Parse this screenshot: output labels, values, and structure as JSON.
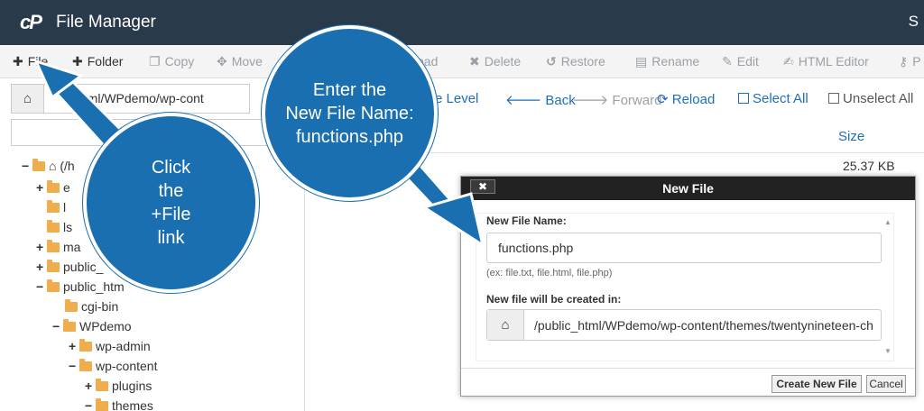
{
  "header": {
    "title": "File Manager",
    "right_letter": "S"
  },
  "toolbar": {
    "file": "File",
    "folder": "Folder",
    "copy": "Copy",
    "move": "Move",
    "upload_partial": "oad",
    "delete": "Delete",
    "restore": "Restore",
    "rename": "Rename",
    "edit": "Edit",
    "html_editor": "HTML Editor",
    "perm_partial": "P"
  },
  "pathbar": {
    "value": "html/WPdemo/wp-cont"
  },
  "nav": {
    "up_partial": "e Level",
    "back": "Back",
    "forward": "Forward",
    "reload": "Reload",
    "select_all": "Select All",
    "unselect_all": "Unselect All"
  },
  "filelist": {
    "size_header": "Size",
    "first_size": "25.37 KB"
  },
  "tree": {
    "root_partial": "(/h",
    "e_partial": "e",
    "l_partial": "l",
    "ls_partial": "ls",
    "ma_partial": "ma",
    "public_partial": "public_",
    "public_html_partial": "public_htm",
    "cgi_bin": "cgi-bin",
    "wpdemo": "WPdemo",
    "wp_admin": "wp-admin",
    "wp_content": "wp-content",
    "plugins": "plugins",
    "themes": "themes"
  },
  "dialog": {
    "title": "New File",
    "close": "✖",
    "name_label": "New File Name:",
    "name_value": "functions.php",
    "hint": "(ex: file.txt, file.html, file.php)",
    "path_label": "New file will be created in:",
    "path_value": "/public_html/WPdemo/wp-content/themes/twentynineteen-ch",
    "create_button": "Create New File",
    "cancel_button": "Cancel"
  },
  "callouts": {
    "left": "Click\nthe\n+File\nlink",
    "top": "Enter the\nNew File Name:\nfunctions.php"
  },
  "colors": {
    "header": "#293a4a",
    "callout": "#1a6fb0",
    "link": "#1f6eb8",
    "folder": "#f0ad4e"
  },
  "icons": [
    "cpanel-logo",
    "plus-icon",
    "copy-icon",
    "move-icon",
    "delete-icon",
    "restore-icon",
    "rename-icon",
    "edit-icon",
    "html-editor-icon",
    "home-icon",
    "back-arrow-icon",
    "forward-arrow-icon",
    "reload-icon",
    "checkbox-icon",
    "folder-icon"
  ]
}
